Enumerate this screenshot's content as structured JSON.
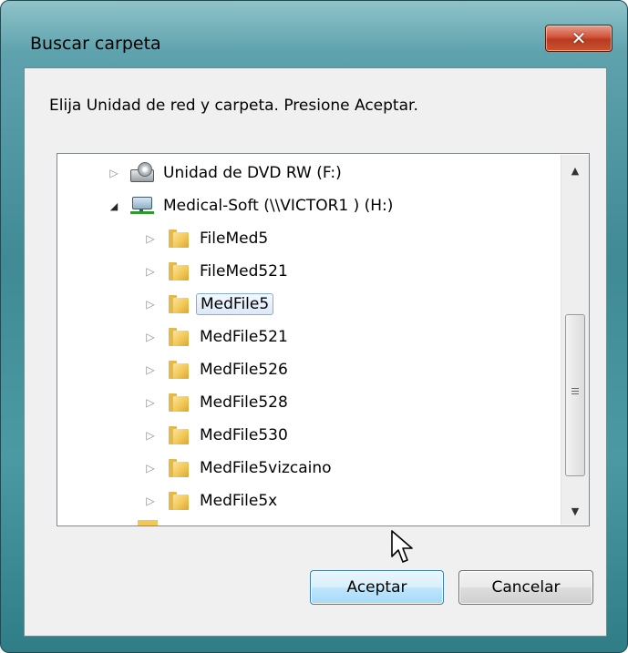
{
  "dialog": {
    "title": "Buscar carpeta",
    "instruction": "Elija Unidad de red y carpeta. Presione Aceptar.",
    "close_icon": "close-icon"
  },
  "tree": {
    "items": [
      {
        "label": "Unidad de DVD RW (F:)",
        "icon": "dvd-drive-icon",
        "expanded": false,
        "level": 1
      },
      {
        "label": "Medical-Soft (\\\\VICTOR1 ) (H:)",
        "icon": "network-drive-icon",
        "expanded": true,
        "level": 1
      },
      {
        "label": "FileMed5",
        "icon": "folder-icon",
        "expanded": false,
        "level": 2
      },
      {
        "label": "FileMed521",
        "icon": "folder-icon",
        "expanded": false,
        "level": 2
      },
      {
        "label": "MedFile5",
        "icon": "folder-icon",
        "expanded": false,
        "level": 2,
        "selected": true
      },
      {
        "label": "MedFile521",
        "icon": "folder-icon",
        "expanded": false,
        "level": 2
      },
      {
        "label": "MedFile526",
        "icon": "folder-icon",
        "expanded": false,
        "level": 2
      },
      {
        "label": "MedFile528",
        "icon": "folder-icon",
        "expanded": false,
        "level": 2
      },
      {
        "label": "MedFile530",
        "icon": "folder-icon",
        "expanded": false,
        "level": 2
      },
      {
        "label": "MedFile5vizcaino",
        "icon": "folder-icon",
        "expanded": false,
        "level": 2
      },
      {
        "label": "MedFile5x",
        "icon": "folder-icon",
        "expanded": false,
        "level": 2
      }
    ]
  },
  "buttons": {
    "ok_label": "Aceptar",
    "cancel_label": "Cancelar"
  },
  "colors": {
    "frame": "#3f8a95",
    "close_button": "#c8552f",
    "selection": "#dbe9f9",
    "ok_button": "#bee6fd"
  }
}
